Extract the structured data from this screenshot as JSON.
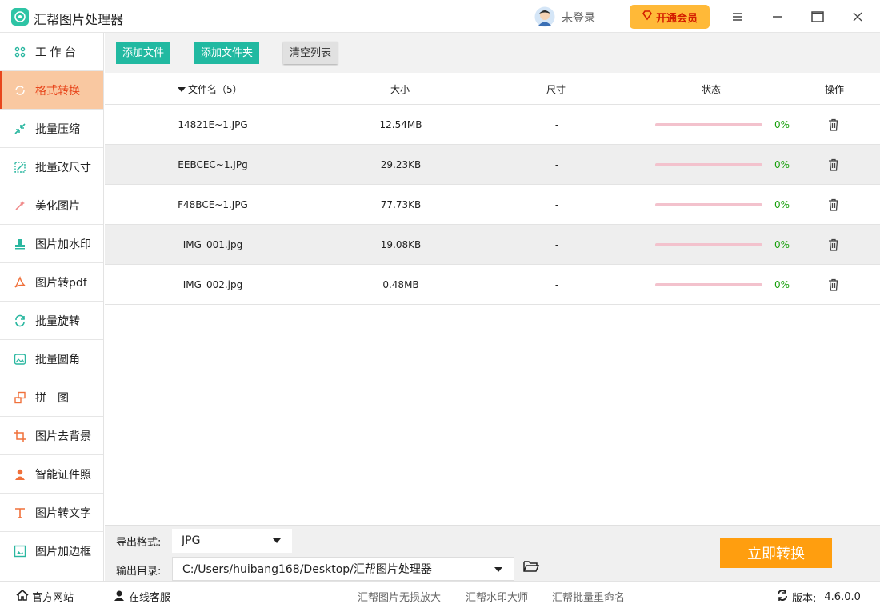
{
  "app": {
    "title": "汇帮图片处理器"
  },
  "header": {
    "login_text": "未登录",
    "vip_label": "开通会员"
  },
  "colors": {
    "accent": "#21b9a1",
    "active_bg": "#f9c8a1",
    "active_text": "#e8461c",
    "convert": "#ff9e0f",
    "vip": "#ffb938",
    "progress_bar": "#f3c2cd",
    "percent_text": "#1aa10e"
  },
  "sidebar": {
    "items": [
      {
        "label": "工 作 台",
        "icon": "grid-icon"
      },
      {
        "label": "格式转换",
        "icon": "convert-icon"
      },
      {
        "label": "批量压缩",
        "icon": "compress-icon"
      },
      {
        "label": "批量改尺寸",
        "icon": "resize-icon"
      },
      {
        "label": "美化图片",
        "icon": "beautify-icon"
      },
      {
        "label": "图片加水印",
        "icon": "watermark-icon"
      },
      {
        "label": "图片转pdf",
        "icon": "pdf-icon"
      },
      {
        "label": "批量旋转",
        "icon": "rotate-icon"
      },
      {
        "label": "批量圆角",
        "icon": "rounded-image-icon"
      },
      {
        "label": "拼　图",
        "icon": "collage-icon"
      },
      {
        "label": "图片去背景",
        "icon": "crop-icon"
      },
      {
        "label": "智能证件照",
        "icon": "person-icon"
      },
      {
        "label": "图片转文字",
        "icon": "text-icon"
      },
      {
        "label": "图片加边框",
        "icon": "frame-icon"
      }
    ]
  },
  "toolbar": {
    "add_file": "添加文件",
    "add_folder": "添加文件夹",
    "clear_list": "清空列表"
  },
  "table": {
    "headers": {
      "name": "文件名（5）",
      "size": "大小",
      "dimensions": "尺寸",
      "status": "状态",
      "action": "操作"
    },
    "rows": [
      {
        "name": "14821E~1.JPG",
        "size": "12.54MB",
        "dimensions": "-",
        "progress": 0,
        "percent": "0%"
      },
      {
        "name": "EEBCEC~1.JPg",
        "size": "29.23KB",
        "dimensions": "-",
        "progress": 0,
        "percent": "0%"
      },
      {
        "name": "F48BCE~1.JPG",
        "size": "77.73KB",
        "dimensions": "-",
        "progress": 0,
        "percent": "0%"
      },
      {
        "name": "IMG_001.jpg",
        "size": "19.08KB",
        "dimensions": "-",
        "progress": 0,
        "percent": "0%"
      },
      {
        "name": "IMG_002.jpg",
        "size": "0.48MB",
        "dimensions": "-",
        "progress": 0,
        "percent": "0%"
      }
    ]
  },
  "bottom": {
    "format_label": "导出格式:",
    "format_value": "JPG",
    "dir_label": "输出目录:",
    "dir_value": "C:/Users/huibang168/Desktop/汇帮图片处理器",
    "convert_label": "立即转换"
  },
  "footer": {
    "website": "官方网站",
    "service": "在线客服",
    "links": [
      "汇帮图片无损放大",
      "汇帮水印大师",
      "汇帮批量重命名"
    ],
    "version_label": "版本:",
    "version_value": "4.6.0.0"
  }
}
